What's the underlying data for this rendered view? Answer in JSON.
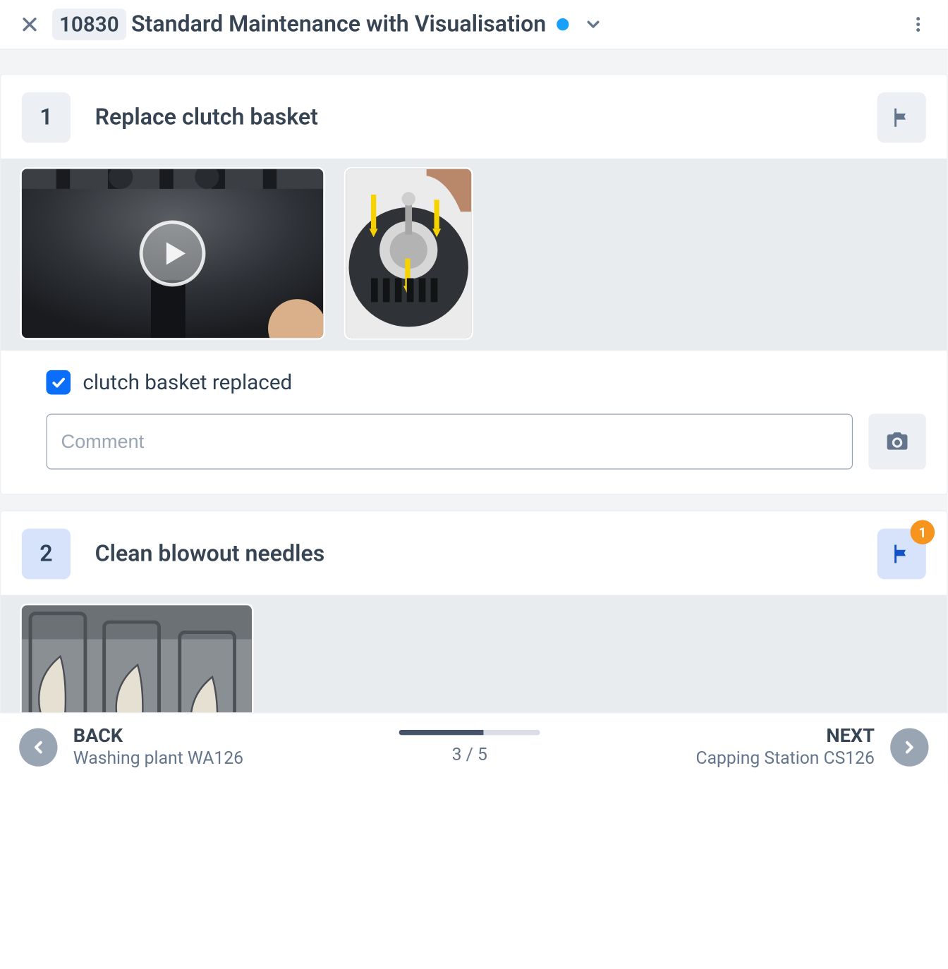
{
  "header": {
    "id": "10830",
    "title": "Standard Maintenance with Visualisation",
    "status_color": "#18a0fb"
  },
  "tasks": [
    {
      "number": "1",
      "title": "Replace clutch basket",
      "flag_active": false,
      "flag_badge": null,
      "media_count": 2,
      "checkbox_checked": true,
      "checkbox_label": "clutch basket replaced",
      "comment_placeholder": "Comment",
      "comment_value": ""
    },
    {
      "number": "2",
      "title": "Clean blowout needles",
      "flag_active": true,
      "flag_badge": "1",
      "media_count": 1
    }
  ],
  "footer": {
    "back_label": "BACK",
    "back_sub": "Washing plant WA126",
    "next_label": "NEXT",
    "next_sub": "Capping Station CS126",
    "page_current": "3",
    "page_sep": " / ",
    "page_total": "5",
    "progress_percent": 60
  }
}
